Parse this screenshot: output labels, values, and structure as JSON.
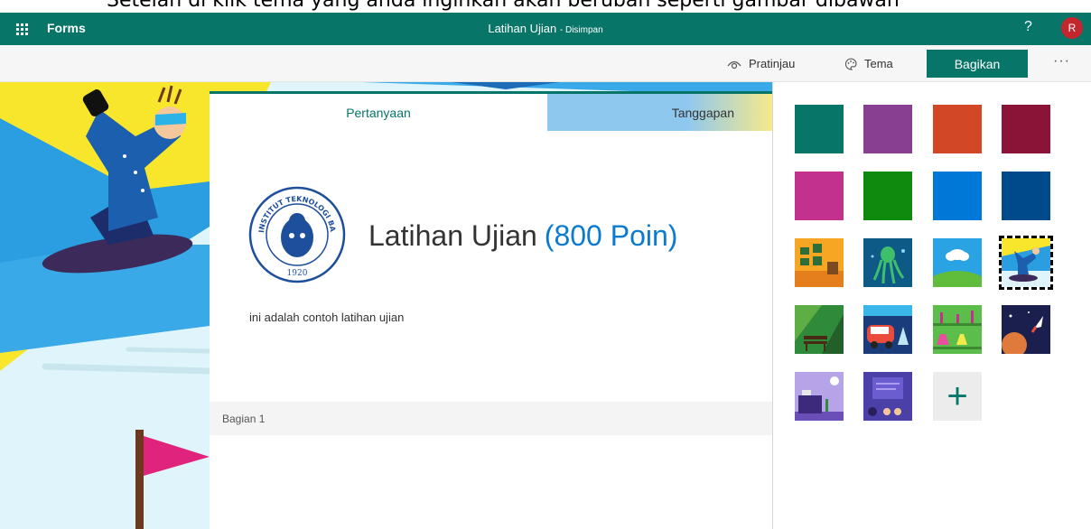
{
  "caption": "Setelah di klik tema yang anda inginkan akan berubah seperti gambar dibawah",
  "topbar": {
    "app_name": "Forms",
    "doc_title": "Latihan Ujian",
    "save_status": "- Disimpan",
    "help": "?",
    "avatar_initial": "R"
  },
  "toolbar": {
    "preview_label": "Pratinjau",
    "theme_label": "Tema",
    "share_label": "Bagikan",
    "more_label": "···"
  },
  "form": {
    "tabs": [
      {
        "label": "Pertanyaan",
        "active": true
      },
      {
        "label": "Tanggapan",
        "active": false
      }
    ],
    "logo_text_top": "INSTITUT TEKNOLOGI BANDUNG",
    "logo_year": "1920",
    "title": "Latihan Ujian",
    "points": "(800 Poin)",
    "description": "ini adalah contoh latihan ujian",
    "section_label": "Bagian 1"
  },
  "themes": {
    "colors": [
      "#077568",
      "#893f91",
      "#d24726",
      "#8a1438",
      "#c2318d",
      "#0f8a0f",
      "#0078d7",
      "#004a8c"
    ],
    "images": [
      "office-room",
      "octopus",
      "cloud-hills",
      "snowboarder",
      "park-bench",
      "camper-van",
      "lab-flasks",
      "space-rocket",
      "desk-clock",
      "classroom-board"
    ],
    "selected": "snowboarder",
    "add_symbol": "+"
  }
}
